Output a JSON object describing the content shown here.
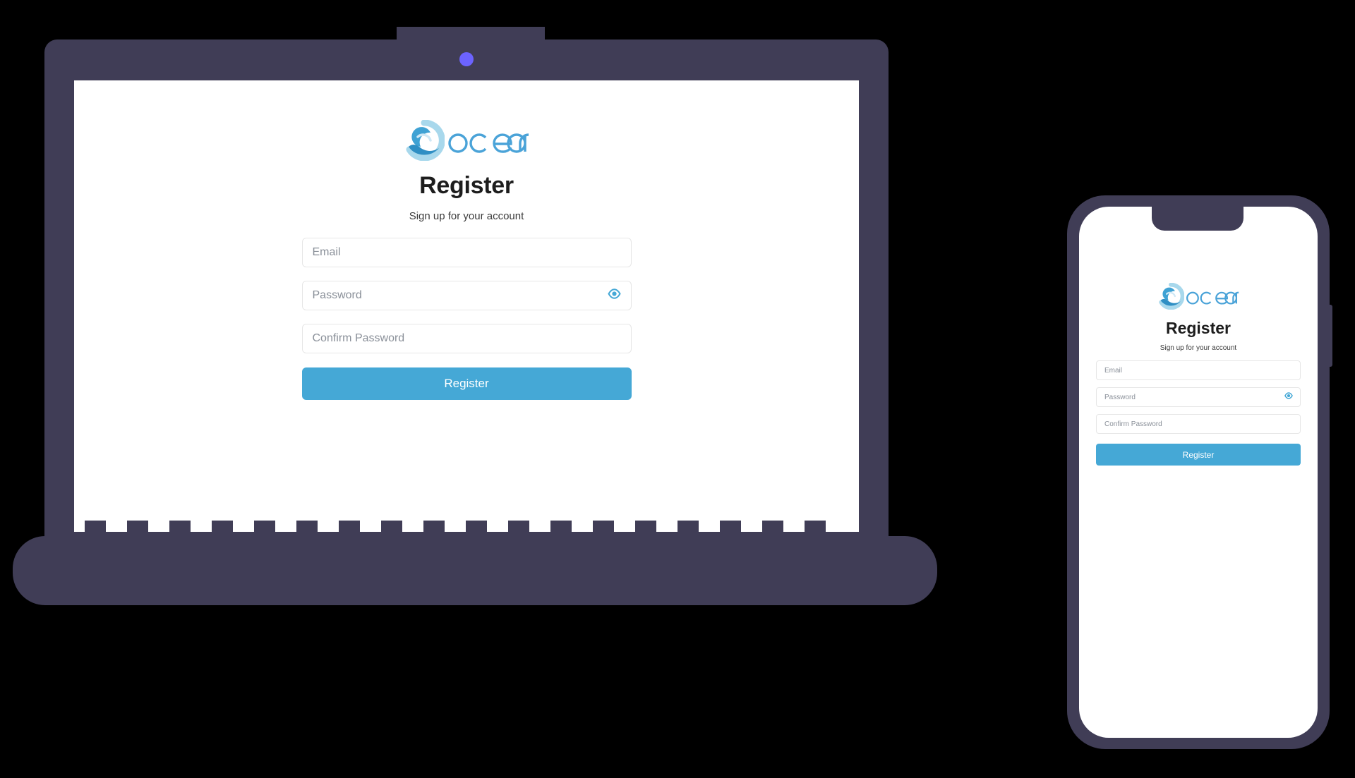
{
  "brand": {
    "name": "ocean",
    "logo_icon": "ocean-wave-circle-icon",
    "logo_light_blue": "#a8d8ec",
    "logo_blue": "#2f8fc4",
    "wordmark_color": "#4aa3d8"
  },
  "theme": {
    "background": "#000000",
    "device_frame": "#403d56",
    "camera_dot": "#6c63ff",
    "screen_background": "#ffffff",
    "accent_button": "#45a8d6",
    "field_border": "#e6e6e6",
    "placeholder_text": "#8a9099",
    "heading_text": "#1d1d1d"
  },
  "register_form": {
    "title": "Register",
    "subtitle": "Sign up for your account",
    "fields": [
      {
        "name": "email",
        "placeholder": "Email",
        "type": "email",
        "value": "",
        "has_reveal_toggle": false
      },
      {
        "name": "password",
        "placeholder": "Password",
        "type": "password",
        "value": "",
        "has_reveal_toggle": true
      },
      {
        "name": "confirm_password",
        "placeholder": "Confirm Password",
        "type": "password",
        "value": "",
        "has_reveal_toggle": false
      }
    ],
    "submit_label": "Register",
    "reveal_icon": "eye-icon"
  },
  "devices": {
    "laptop": {
      "type": "laptop-mockup",
      "camera_icon": "camera-dot-icon"
    },
    "phone": {
      "type": "phone-mockup",
      "notch": "phone-notch",
      "side_button": "power-button"
    }
  }
}
